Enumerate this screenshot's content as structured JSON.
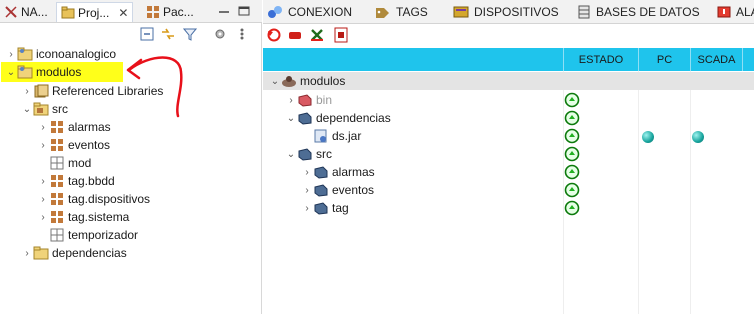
{
  "left_tabs": [
    {
      "label": "NA..."
    },
    {
      "label": "Proj..."
    },
    {
      "label": "Pac..."
    }
  ],
  "left_tree": [
    {
      "label": "iconoanalogico"
    },
    {
      "label": "modulos"
    },
    {
      "label": "Referenced Libraries"
    },
    {
      "label": "src"
    },
    {
      "label": "alarmas"
    },
    {
      "label": "eventos"
    },
    {
      "label": "mod"
    },
    {
      "label": "tag.bbdd"
    },
    {
      "label": "tag.dispositivos"
    },
    {
      "label": "tag.sistema"
    },
    {
      "label": "temporizador"
    },
    {
      "label": "dependencias"
    }
  ],
  "right_tabs": [
    {
      "label": "CONEXION"
    },
    {
      "label": "TAGS"
    },
    {
      "label": "DISPOSITIVOS"
    },
    {
      "label": "BASES DE DATOS"
    },
    {
      "label": "ALA"
    }
  ],
  "grid": {
    "columns": [
      "ESTADO",
      "PC",
      "SCADA"
    ],
    "root_label": "modulos",
    "rows": [
      {
        "label": "bin"
      },
      {
        "label": "dependencias"
      },
      {
        "label": "ds.jar"
      },
      {
        "label": "src"
      },
      {
        "label": "alarmas"
      },
      {
        "label": "eventos"
      },
      {
        "label": "tag"
      }
    ]
  },
  "colors": {
    "header_accent": "#1fc4ec",
    "highlight": "#ffff1a",
    "annotation": "#e8101a"
  }
}
